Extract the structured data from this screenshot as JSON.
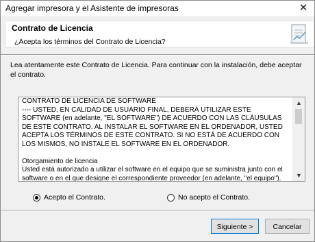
{
  "window": {
    "title": "Agregar impresora y el Asistente de impresoras",
    "close_glyph": "✕"
  },
  "header": {
    "title": "Contrato de Licencia",
    "subtitle": "¿Acepta los términos del Contrato de Licencia?",
    "icon": "license-document-icon"
  },
  "intro": "Lea atentamente este Contrato de Licencia. Para continuar con la instalación, debe aceptar el contrato.",
  "license": {
    "paragraph1": "CONTRATO DE LICENCIA DE SOFTWARE\n---- USTED, EN CALIDAD DE USUARIO FINAL, DEBERÁ UTILIZAR ESTE SOFTWARE (en adelante, \"EL SOFTWARE\") DE ACUERDO CON LAS CLÁUSULAS DE ESTE CONTRATO. AL INSTALAR EL SOFTWARE EN EL ORDENADOR, USTED ACEPTA LOS TÉRMINOS DE ESTE CONTRATO. SI NO ESTÁ DE ACUERDO CON LOS MISMOS, NO INSTALE EL SOFTWARE EN EL ORDENADOR.",
    "paragraph2": "Otorgamiento de licencia\nUsted está autorizado a utilizar el software en el equipo que se suministra junto con el software o en el que designe el correspondiente proveedor (en adelante, \"el equipo\")."
  },
  "options": {
    "accept": "Acepto el Contrato.",
    "decline": "No acepto el Contrato.",
    "selected": "accept"
  },
  "buttons": {
    "next": "Siguiente >",
    "cancel": "Cancelar"
  }
}
